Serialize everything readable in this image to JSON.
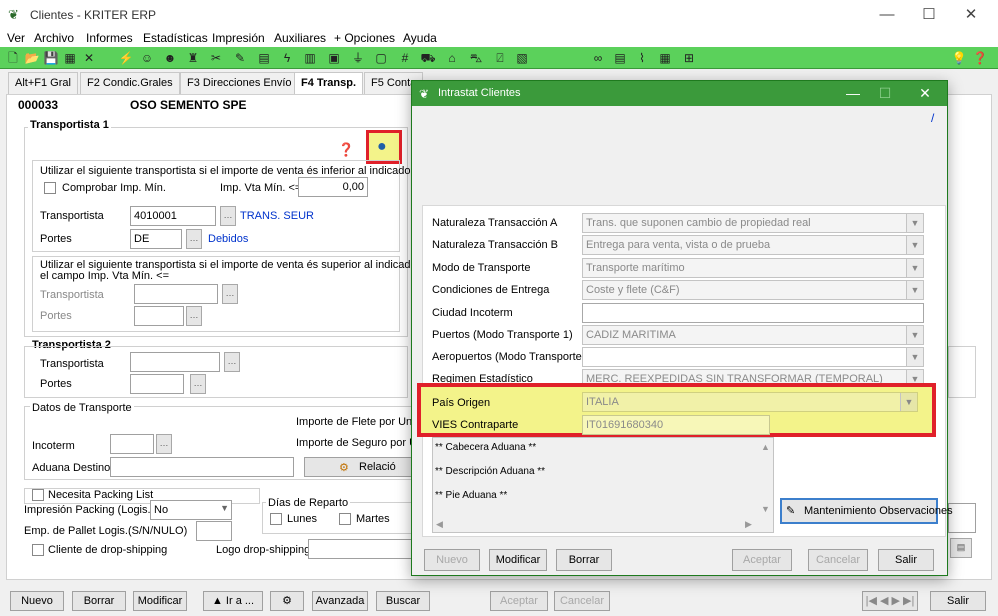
{
  "window": {
    "title": "Clientes - KRITER ERP",
    "minimize": "—",
    "maximize": "☐",
    "close": "✕"
  },
  "menu": [
    "Ver",
    "Archivo",
    "Informes",
    "Estadísticas",
    "Impresión",
    "Auxiliares",
    "+ Opciones",
    "Ayuda"
  ],
  "tabs": [
    "Alt+F1 Gral",
    "F2 Condic.Grales",
    "F3 Direcciones Envío",
    "F4 Transp.",
    "F5 Conta"
  ],
  "client": {
    "code": "000033",
    "name": "OSO SEMENTO SPE"
  },
  "transportista1": {
    "heading": "Transportista 1",
    "inferior_text": "Utilizar el siguiente transportista si el importe de venta és inferior al indicado.",
    "comprobar_label": "Comprobar Imp. Mín.",
    "imp_vta_label": "Imp. Vta Mín. <=",
    "imp_vta_value": "0,00",
    "transportista_label": "Transportista",
    "transportista_value": "4010001",
    "transportista_name": "TRANS. SEUR",
    "portes_label": "Portes",
    "portes_value": "DE",
    "portes_name": "Debidos",
    "superior_text1": "Utilizar el siguiente transportista si el importe de venta és superior al indicado en",
    "superior_text2": "el campo Imp. Vta Mín. <=",
    "transportista2_label": "Transportista",
    "portes2_label": "Portes"
  },
  "transportista2": {
    "heading": "Transportista 2",
    "transportista_label": "Transportista",
    "portes_label": "Portes"
  },
  "datos_transporte": {
    "heading": "Datos de Transporte",
    "incoterm_label": "Incoterm",
    "aduana_label": "Aduana Destino",
    "flete_label": "Importe de Flete por Unida",
    "seguro_label": "Importe de Seguro por Un",
    "relacion_label": "Relació"
  },
  "packing": {
    "necesita_label": "Necesita Packing List",
    "impresion_label": "Impresión Packing (Logis.)",
    "impresion_value": "No",
    "pallet_label": "Emp. de Pallet Logis.(S/N/NULO)",
    "dropship_label": "Cliente de drop-shipping",
    "logo_label": "Logo drop-shipping",
    "dias_label": "Días de Reparto",
    "lunes": "Lunes",
    "martes": "Martes"
  },
  "bottom_buttons": [
    "Nuevo",
    "Borrar",
    "Modificar",
    "▲ Ir a ...",
    "Avanzada",
    "Buscar",
    "Aceptar",
    "Cancelar",
    "Salir"
  ],
  "dialog": {
    "title": "Intrastat Clientes",
    "slash": "/",
    "fields": [
      {
        "label": "Naturaleza Transacción A",
        "value": "Trans. que suponen cambio de propiedad real"
      },
      {
        "label": "Naturaleza Transacción B",
        "value": "Entrega para venta, vista o de prueba"
      },
      {
        "label": "Modo de Transporte",
        "value": "Transporte marítimo"
      },
      {
        "label": "Condiciones de Entrega",
        "value": "Coste y flete (C&F)"
      },
      {
        "label": "Ciudad Incoterm",
        "value": ""
      },
      {
        "label": "Puertos (Modo Transporte 1)",
        "value": "CADIZ MARITIMA"
      },
      {
        "label": "Aeropuertos (Modo Transporte 4)",
        "value": ""
      },
      {
        "label": "Regimen Estadístico",
        "value": "MERC. REEXPEDIDAS SIN TRANSFORMAR (TEMPORAL)"
      },
      {
        "label": "País Origen",
        "value": "ITALIA"
      },
      {
        "label": "VIES Contraparte",
        "value": "IT01691680340"
      }
    ],
    "memo_lines": [
      "** Cabecera Aduana **",
      "** Descripción Aduana **",
      "** Pie Aduana **"
    ],
    "mantenimiento_label": "Mantenimiento Observaciones",
    "buttons": [
      "Nuevo",
      "Modificar",
      "Borrar",
      "Aceptar",
      "Cancelar",
      "Salir"
    ]
  },
  "colors": {
    "toolbar": "#5bd15b",
    "dialog_title": "#3b9a3b",
    "highlight_border": "#e0202a",
    "highlight_fill": "#f3f38a",
    "link": "#0033cc"
  }
}
